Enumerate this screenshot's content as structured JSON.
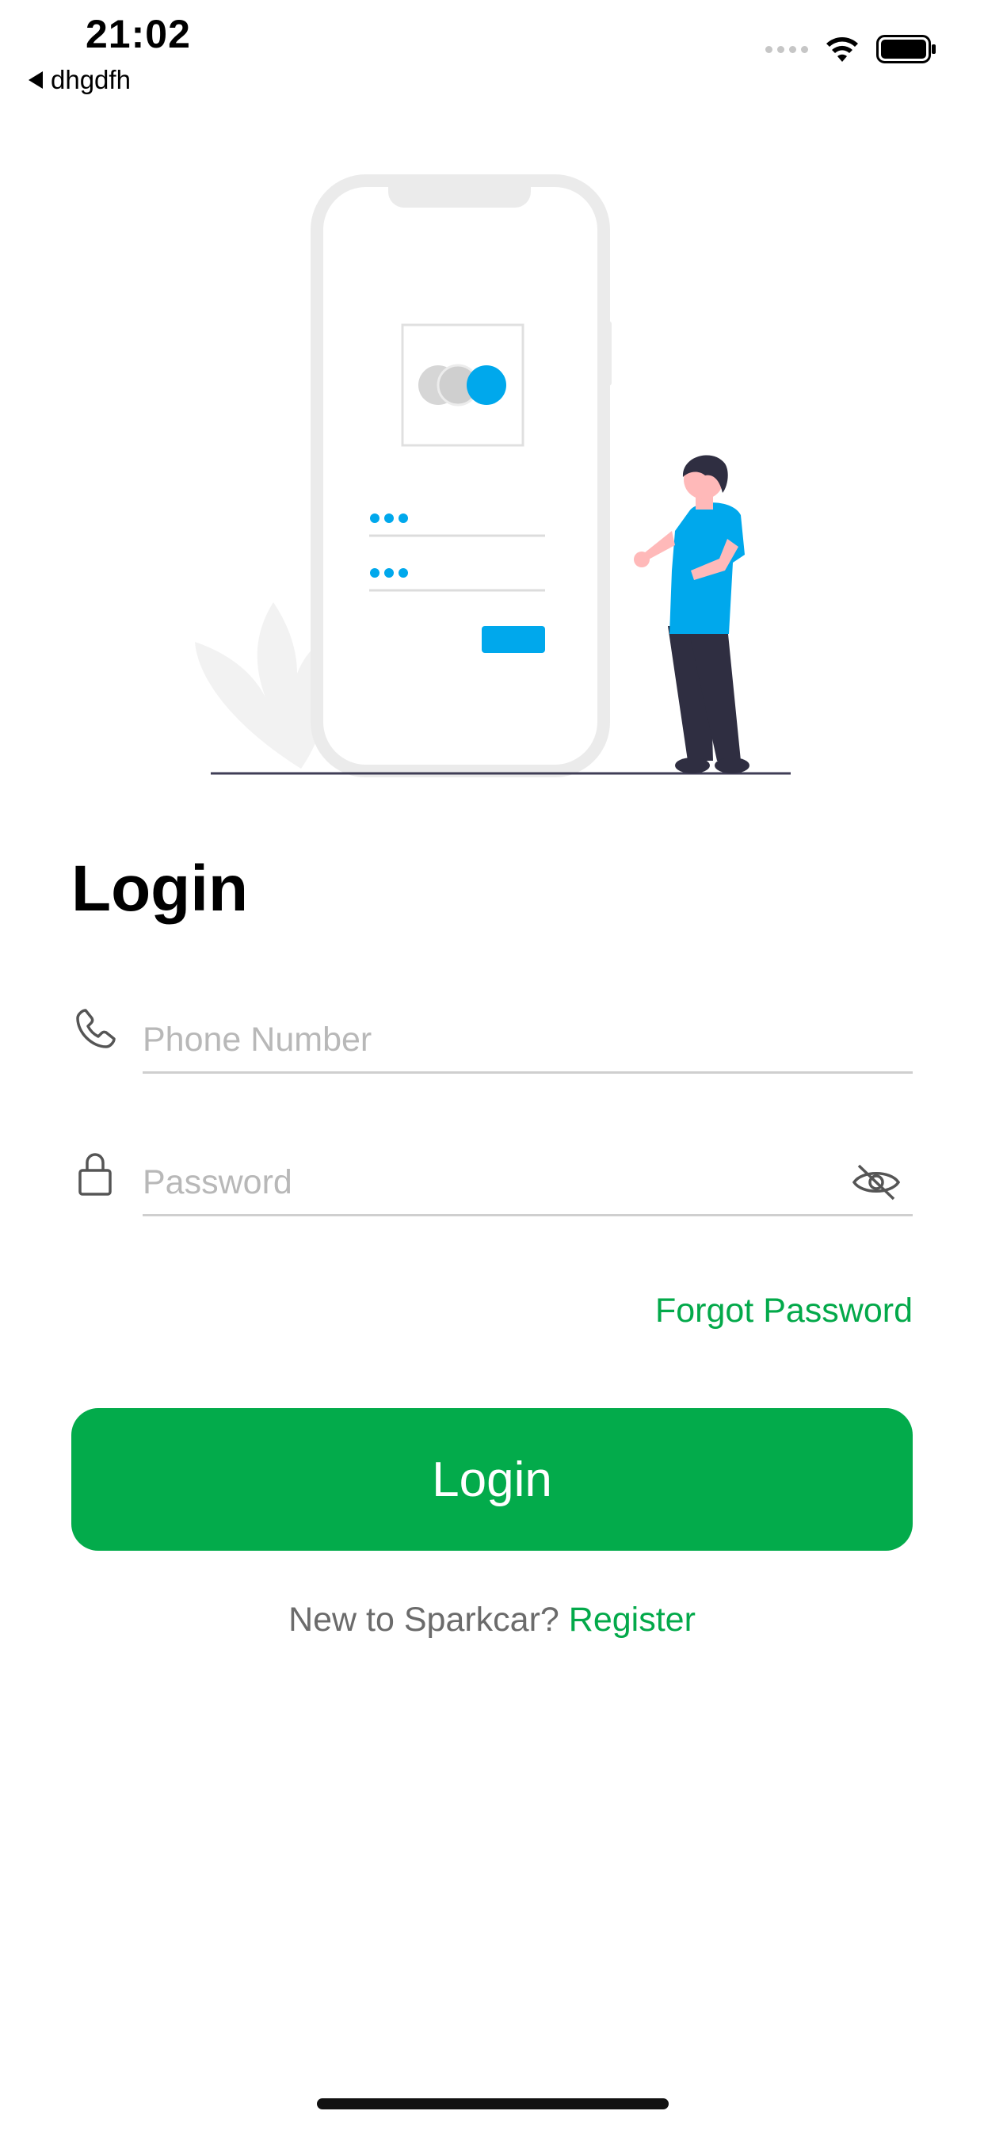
{
  "status_bar": {
    "time": "21:02",
    "back_app": "dhgdfh"
  },
  "page": {
    "title": "Login"
  },
  "form": {
    "phone": {
      "placeholder": "Phone Number",
      "value": ""
    },
    "password": {
      "placeholder": "Password",
      "value": ""
    },
    "forgot_password_label": "Forgot Password",
    "login_button_label": "Login"
  },
  "footer": {
    "register_prompt": "New to Sparkcar?",
    "register_link": "Register"
  },
  "colors": {
    "accent_green": "#03ab4b",
    "illustration_blue": "#00a8ec",
    "placeholder_gray": "#b8b8b8"
  },
  "icons": [
    "back-arrow-icon",
    "signal-icon",
    "wifi-icon",
    "battery-icon",
    "phone-icon",
    "lock-icon",
    "eye-off-icon"
  ]
}
